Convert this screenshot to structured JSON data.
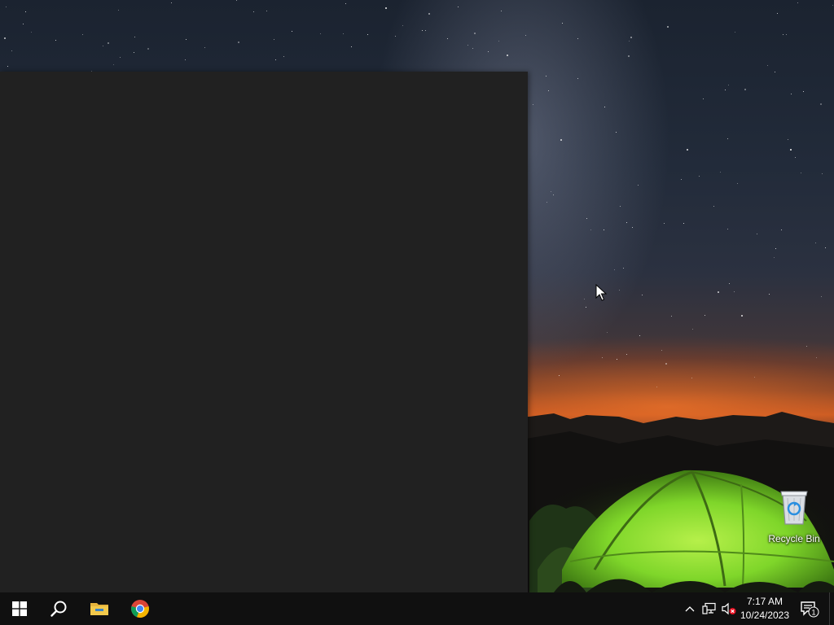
{
  "desktop": {
    "icons": [
      {
        "label": "Recycle Bin",
        "icon": "recycle-bin-icon"
      }
    ]
  },
  "taskbar": {
    "start_icon": "windows-logo-icon",
    "search_icon": "search-icon",
    "pinned_apps": [
      {
        "name": "file-explorer",
        "icon": "folder-icon",
        "color": "#f2c94c"
      },
      {
        "name": "google-chrome",
        "icon": "chrome-icon"
      }
    ],
    "tray": {
      "icons": [
        "chevron-up-icon",
        "network-icon",
        "volume-muted-icon"
      ],
      "time": "7:17 AM",
      "date": "10/24/2023",
      "notification_count": "1"
    }
  },
  "colors": {
    "taskbar_bg": "#101010",
    "panel_bg": "#212121",
    "tent_green": "#7fd62a"
  }
}
